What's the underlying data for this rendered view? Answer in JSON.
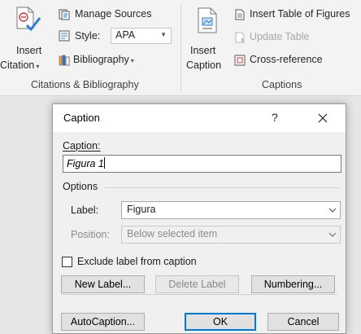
{
  "ribbon": {
    "insert_citation_line1": "Insert",
    "insert_citation_line2": "Citation",
    "manage_sources": "Manage Sources",
    "style_label": "Style:",
    "style_value": "APA",
    "bibliography": "Bibliography",
    "group_citations": "Citations & Bibliography",
    "insert_caption_line1": "Insert",
    "insert_caption_line2": "Caption",
    "insert_table_of_figures": "Insert Table of Figures",
    "update_table": "Update Table",
    "cross_reference": "Cross-reference",
    "group_captions": "Captions"
  },
  "dialog": {
    "title": "Caption",
    "help": "?",
    "caption_label": "Caption:",
    "caption_value": "Figura 1",
    "options_label": "Options",
    "label_label": "Label:",
    "label_value": "Figura",
    "position_label": "Position:",
    "position_value": "Below selected item",
    "exclude_label": "Exclude label from caption",
    "new_label": "New Label...",
    "delete_label": "Delete Label",
    "numbering": "Numbering...",
    "autocaption": "AutoCaption...",
    "ok": "OK",
    "cancel": "Cancel"
  },
  "colors": {
    "accent_blue": "#0078d7",
    "icon_red": "#d13438",
    "icon_blue": "#2b7cd3"
  }
}
